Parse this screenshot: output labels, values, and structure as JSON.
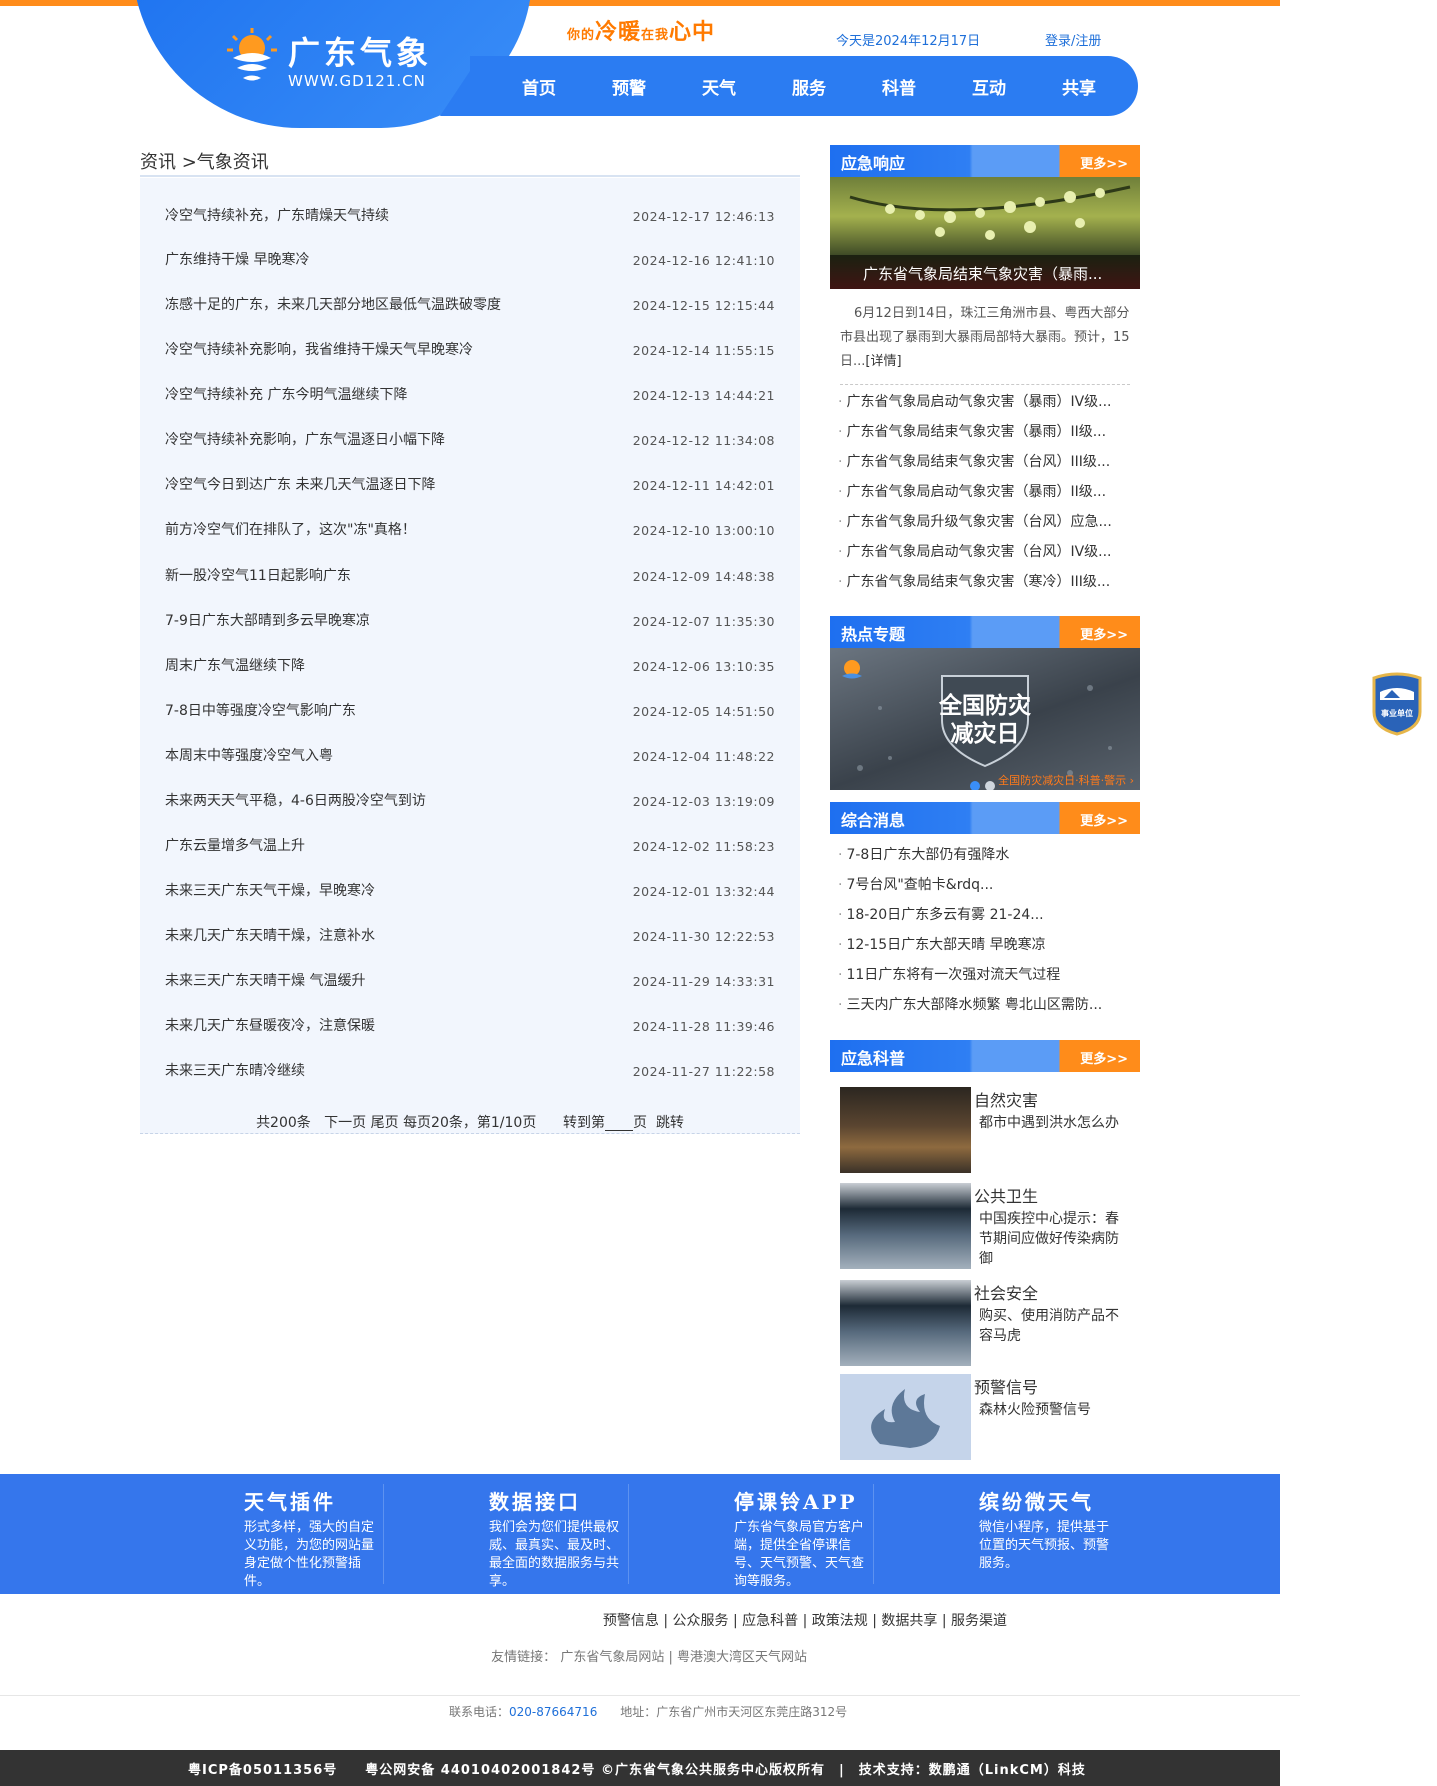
{
  "header": {
    "logo_text": "广东气象",
    "logo_url": "WWW.GD121.CN",
    "slogan_a": "你的",
    "slogan_b": "冷暖",
    "slogan_c": "在我",
    "slogan_d": "心中",
    "today": "今天是2024年12月17日",
    "login": "登录/注册",
    "nav": [
      "首页",
      "预警",
      "天气",
      "服务",
      "科普",
      "互动",
      "共享"
    ]
  },
  "breadcrumb": "资讯 >气象资讯",
  "news": [
    {
      "title": "冷空气持续补充，广东晴燥天气持续",
      "date": "2024-12-17 12:46:13"
    },
    {
      "title": "广东维持干燥 早晚寒冷",
      "date": "2024-12-16 12:41:10"
    },
    {
      "title": "冻感十足的广东，未来几天部分地区最低气温跌破零度",
      "date": "2024-12-15 12:15:44"
    },
    {
      "title": "冷空气持续补充影响，我省维持干燥天气早晚寒冷",
      "date": "2024-12-14 11:55:15"
    },
    {
      "title": "冷空气持续补充 广东今明气温继续下降",
      "date": "2024-12-13 14:44:21"
    },
    {
      "title": "冷空气持续补充影响，广东气温逐日小幅下降",
      "date": "2024-12-12 11:34:08"
    },
    {
      "title": "冷空气今日到达广东 未来几天气温逐日下降",
      "date": "2024-12-11 14:42:01"
    },
    {
      "title": "前方冷空气们在排队了，这次\"冻\"真格！",
      "date": "2024-12-10 13:00:10"
    },
    {
      "title": "新一股冷空气11日起影响广东",
      "date": "2024-12-09 14:48:38"
    },
    {
      "title": "7-9日广东大部晴到多云早晚寒凉",
      "date": "2024-12-07 11:35:30"
    },
    {
      "title": "周末广东气温继续下降",
      "date": "2024-12-06 13:10:35"
    },
    {
      "title": "7-8日中等强度冷空气影响广东",
      "date": "2024-12-05 14:51:50"
    },
    {
      "title": "本周末中等强度冷空气入粤",
      "date": "2024-12-04 11:48:22"
    },
    {
      "title": "未来两天天气平稳，4-6日两股冷空气到访",
      "date": "2024-12-03 13:19:09"
    },
    {
      "title": "广东云量增多气温上升",
      "date": "2024-12-02 11:58:23"
    },
    {
      "title": "未来三天广东天气干燥，早晚寒冷",
      "date": "2024-12-01 13:32:44"
    },
    {
      "title": "未来几天广东天晴干燥，注意补水",
      "date": "2024-11-30 12:22:53"
    },
    {
      "title": "未来三天广东天晴干燥 气温缓升",
      "date": "2024-11-29 14:33:31"
    },
    {
      "title": "未来几天广东昼暖夜冷，注意保暖",
      "date": "2024-11-28 11:39:46"
    },
    {
      "title": "未来三天广东晴冷继续",
      "date": "2024-11-27 11:22:58"
    }
  ],
  "pager": {
    "total": "共200条",
    "next": "下一页",
    "last": "尾页",
    "info": "每页20条，第1/10页",
    "goto_prefix": "转到第",
    "goto_suffix": "页",
    "jump": "跳转"
  },
  "emergency": {
    "title": "应急响应",
    "more": "更多>>",
    "image_caption": "广东省气象局结束气象灾害（暴雨...",
    "summary": "6月12日到14日，珠江三角洲市县、粤西大部分市县出现了暴雨到大暴雨局部特大暴雨。预计，15日...",
    "detail_link": "[详情]",
    "items": [
      "广东省气象局启动气象灾害（暴雨）IV级...",
      "广东省气象局结束气象灾害（暴雨）II级...",
      "广东省气象局结束气象灾害（台风）III级...",
      "广东省气象局启动气象灾害（暴雨）II级...",
      "广东省气象局升级气象灾害（台风）应急...",
      "广东省气象局启动气象灾害（台风）IV级...",
      "广东省气象局结束气象灾害（寒冷）III级..."
    ]
  },
  "hot": {
    "title": "热点专题",
    "more": "更多>>",
    "banner_main": "全国防灾",
    "banner_main2": "减灾日",
    "banner_caption": "全国防灾减灾日·科普·警示 ›"
  },
  "news_side": {
    "title": "综合消息",
    "more": "更多>>",
    "items": [
      "7-8日广东大部仍有强降水",
      "7号台风\"查帕卡&rdq...",
      "18-20日广东多云有雾 21-24...",
      "12-15日广东大部天晴 早晚寒凉",
      "11日广东将有一次强对流天气过程",
      "三天内广东大部降水频繁 粤北山区需防..."
    ]
  },
  "science": {
    "title": "应急科普",
    "more": "更多>>",
    "items": [
      {
        "category": "自然灾害",
        "desc": "都市中遇到洪水怎么办"
      },
      {
        "category": "公共卫生",
        "desc": "中国疾控中心提示：春节期间应做好传染病防御"
      },
      {
        "category": "社会安全",
        "desc": "购买、使用消防产品不容马虎"
      },
      {
        "category": "预警信号",
        "desc": "森林火险预警信号"
      }
    ]
  },
  "badge": "事业单位",
  "footer": {
    "cols": [
      {
        "title": "天气插件",
        "desc": "形式多样，强大的自定义功能，为您的网站量身定做个性化预警插件。"
      },
      {
        "title": "数据接口",
        "desc": "我们会为您们提供最权威、最真实、最及时、最全面的数据服务与共享。"
      },
      {
        "title": "停课铃APP",
        "desc": "广东省气象局官方客户端，提供全省停课信号、天气预警、天气查询等服务。"
      },
      {
        "title": "缤纷微天气",
        "desc": "微信小程序，提供基于位置的天气预报、预警服务。"
      }
    ],
    "links": [
      "预警信息",
      "公众服务",
      "应急科普",
      "政策法规",
      "数据共享",
      "服务渠道"
    ],
    "friend_label": "友情链接：",
    "friend_links": [
      "广东省气象局网站",
      "粤港澳大湾区天气网站"
    ],
    "tel_label": "联系电话：",
    "tel": "020-87664716",
    "address": "地址：广东省广州市天河区东莞庄路312号",
    "copyright": "粤ICP备05011356号　　粤公网安备 44010402001842号 ©广东省气象公共服务中心版权所有　|　技术支持：数鹏通（LinkCM）科技"
  }
}
